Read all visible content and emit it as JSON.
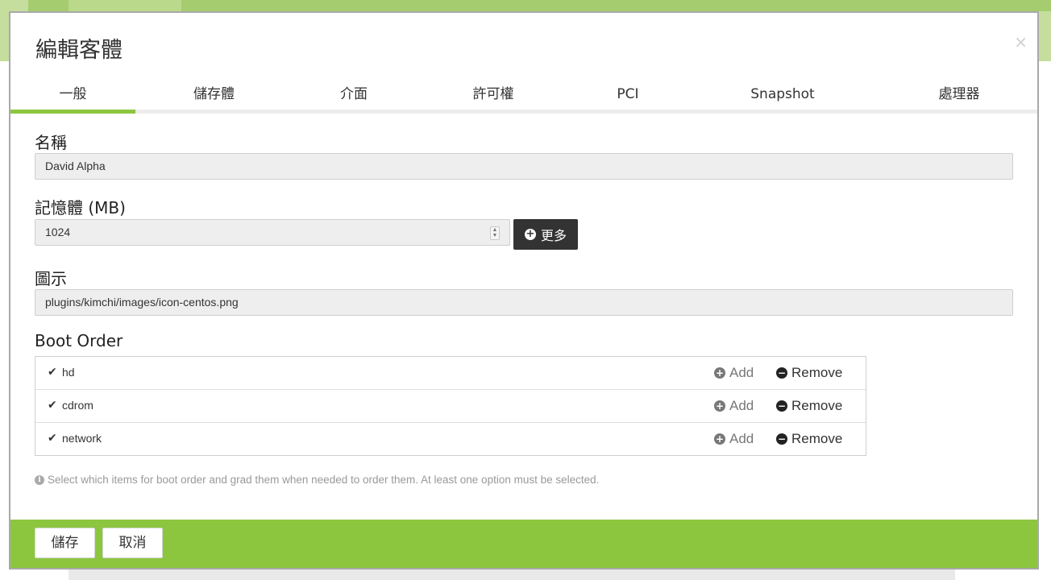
{
  "modal": {
    "title": "編輯客體",
    "close_glyph": "×"
  },
  "tabs": [
    {
      "label": "一般",
      "active": true
    },
    {
      "label": "儲存體",
      "active": false
    },
    {
      "label": "介面",
      "active": false
    },
    {
      "label": "許可權",
      "active": false
    },
    {
      "label": "PCI",
      "active": false
    },
    {
      "label": "Snapshot",
      "active": false
    },
    {
      "label": "處理器",
      "active": false
    }
  ],
  "form": {
    "name_label": "名稱",
    "name_value": "David Alpha",
    "memory_label": "記憶體 (MB)",
    "memory_value": "1024",
    "more_button": "更多",
    "icon_label": "圖示",
    "icon_value": "plugins/kimchi/images/icon-centos.png",
    "boot_order_label": "Boot Order",
    "boot_items": [
      {
        "name": "hd",
        "checked": true,
        "add_label": "Add",
        "remove_label": "Remove"
      },
      {
        "name": "cdrom",
        "checked": true,
        "add_label": "Add",
        "remove_label": "Remove"
      },
      {
        "name": "network",
        "checked": true,
        "add_label": "Add",
        "remove_label": "Remove"
      }
    ],
    "help_text": "Select which items for boot order and grad them when needed to order them. At least one option must be selected."
  },
  "footer": {
    "save_label": "儲存",
    "cancel_label": "取消"
  },
  "colors": {
    "accent_green": "#8cc63f",
    "dark_button": "#333333"
  }
}
